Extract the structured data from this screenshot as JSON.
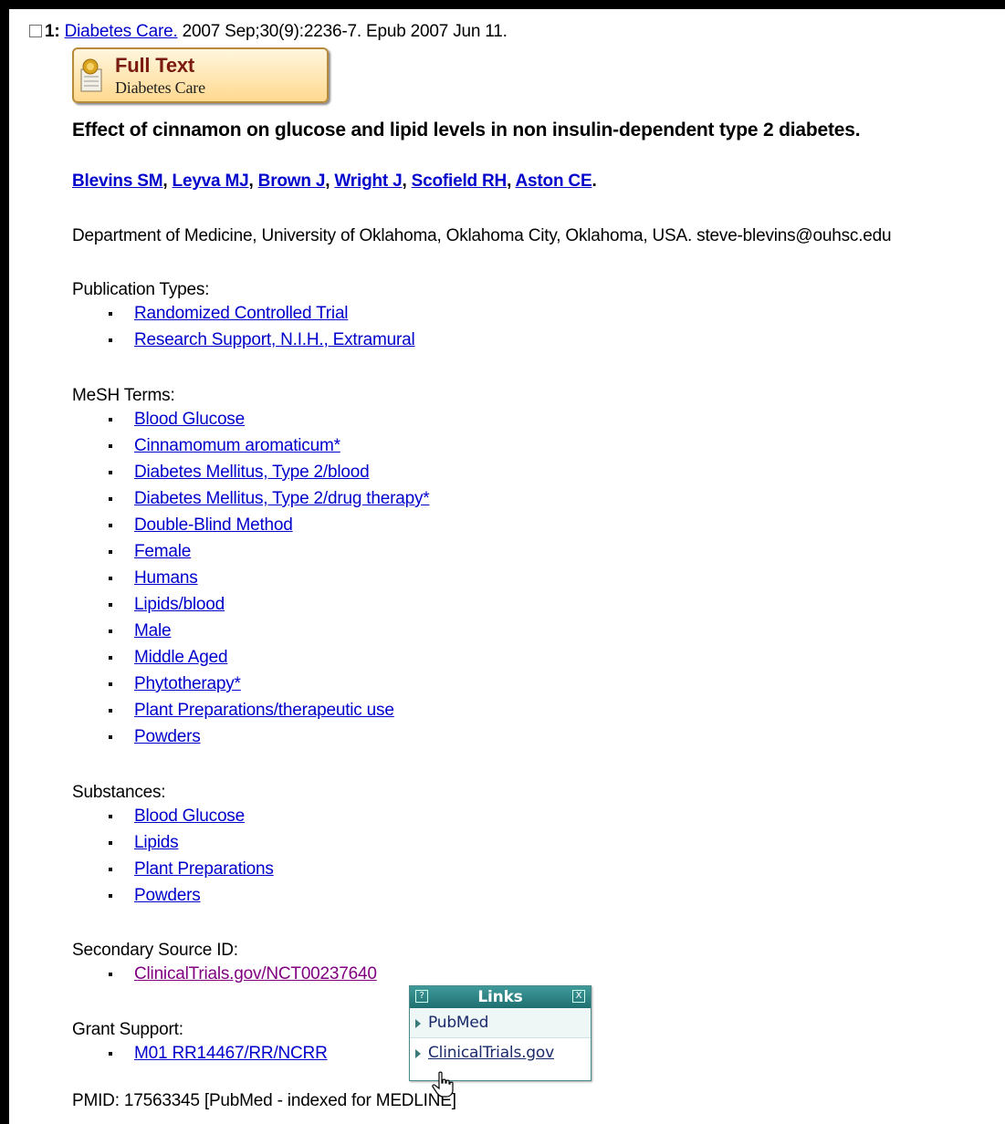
{
  "record": {
    "rank": "1:",
    "journal": "Diabetes Care.",
    "citation": " 2007 Sep;30(9):2236-7. Epub 2007 Jun 11."
  },
  "full_text_badge": {
    "title": "Full Text",
    "subtitle": "Diabetes Care"
  },
  "article_title": "Effect of cinnamon on glucose and lipid levels in non insulin-dependent type 2 diabetes.",
  "authors": [
    "Blevins SM",
    "Leyva MJ",
    "Brown J",
    "Wright J",
    "Scofield RH",
    "Aston CE"
  ],
  "affiliation": "Department of Medicine, University of Oklahoma, Oklahoma City, Oklahoma, USA. steve-blevins@ouhsc.edu",
  "publication_types": {
    "label": "Publication Types:",
    "items": [
      "Randomized Controlled Trial",
      "Research Support, N.I.H., Extramural"
    ]
  },
  "mesh_terms": {
    "label": "MeSH Terms:",
    "items": [
      "Blood Glucose",
      "Cinnamomum aromaticum*",
      "Diabetes Mellitus, Type 2/blood",
      "Diabetes Mellitus, Type 2/drug therapy*",
      "Double-Blind Method",
      "Female",
      "Humans",
      "Lipids/blood",
      "Male",
      "Middle Aged",
      "Phytotherapy*",
      "Plant Preparations/therapeutic use",
      "Powders"
    ]
  },
  "substances": {
    "label": "Substances:",
    "items": [
      "Blood Glucose",
      "Lipids",
      "Plant Preparations",
      "Powders"
    ]
  },
  "secondary_source": {
    "label": "Secondary Source ID:",
    "items": [
      "ClinicalTrials.gov/NCT00237640"
    ]
  },
  "grant_support": {
    "label": "Grant Support:",
    "items": [
      "M01 RR14467/RR/NCRR"
    ]
  },
  "pmid_line": "PMID: 17563345 [PubMed - indexed for MEDLINE]",
  "links_popup": {
    "title": "Links",
    "help": "?",
    "close": "X",
    "items": [
      "PubMed",
      "ClinicalTrials.gov"
    ]
  },
  "colors": {
    "link": "#0000cc",
    "visited_link": "#800080",
    "popup_header": "#2a8080",
    "badge_border": "#b88a3b"
  }
}
